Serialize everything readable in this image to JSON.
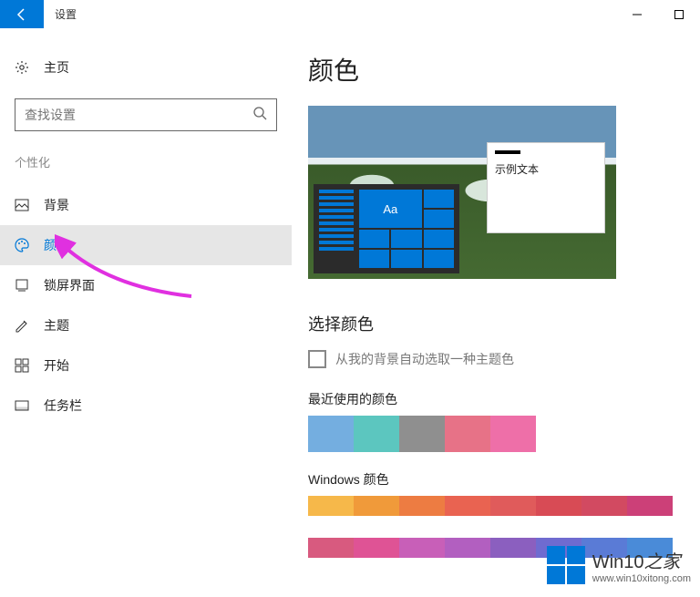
{
  "titlebar": {
    "app_title": "设置"
  },
  "sidebar": {
    "home_label": "主页",
    "search_placeholder": "查找设置",
    "section_label": "个性化",
    "items": [
      {
        "label": "背景"
      },
      {
        "label": "颜色"
      },
      {
        "label": "锁屏界面"
      },
      {
        "label": "主题"
      },
      {
        "label": "开始"
      },
      {
        "label": "任务栏"
      }
    ]
  },
  "main": {
    "title": "颜色",
    "preview": {
      "sample_text": "示例文本",
      "tile_text": "Aa"
    },
    "choose_color_heading": "选择颜色",
    "auto_pick_label": "从我的背景自动选取一种主题色",
    "recent_label": "最近使用的颜色",
    "recent_colors": [
      "#74aee0",
      "#5cc6bf",
      "#8f8f8f",
      "#e77287",
      "#ee6fa8"
    ],
    "windows_colors_label": "Windows 颜色",
    "windows_colors_row1": [
      "#f6b84a",
      "#f09a3a",
      "#ed7c42",
      "#e96351",
      "#e05b5b",
      "#d84b55",
      "#d24a61",
      "#cc4078"
    ],
    "windows_colors_row2": [
      "#d85a7f",
      "#df5395",
      "#c85fb8",
      "#b25fc0",
      "#8b5fbf",
      "#6f6bd0",
      "#5a7bd6",
      "#4a8bd8"
    ]
  },
  "watermark": {
    "brand": "Win10",
    "suffix": "之家",
    "url": "www.win10xitong.com"
  }
}
